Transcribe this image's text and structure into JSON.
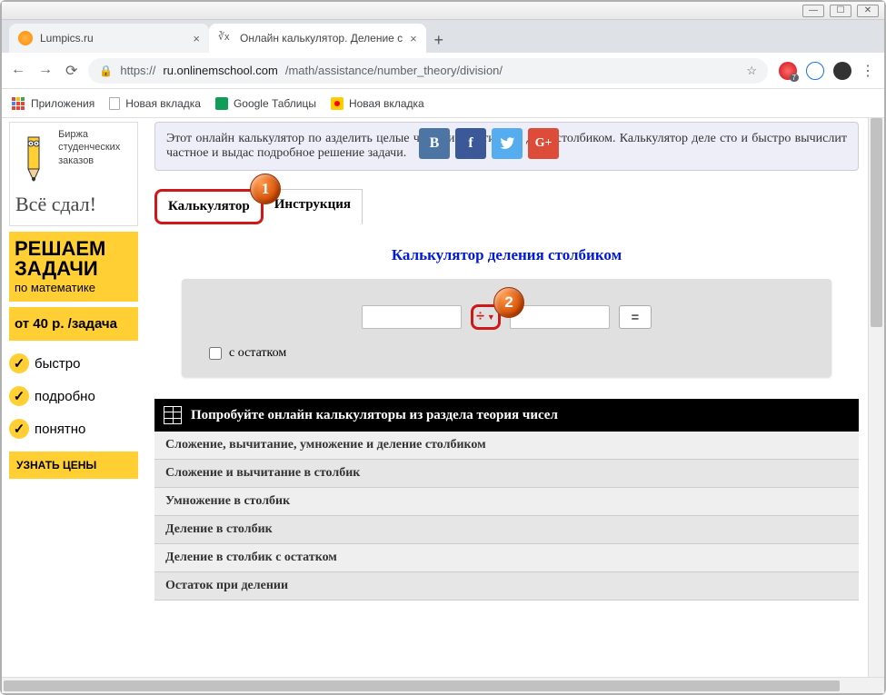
{
  "window": {
    "controls": {
      "min": "—",
      "max": "☐",
      "close": "✕"
    }
  },
  "browser": {
    "tabs": [
      {
        "title": "Lumpics.ru",
        "active": false
      },
      {
        "title": "Онлайн калькулятор. Деление с",
        "active": true
      }
    ],
    "url_prefix": "https://",
    "url_host": "ru.onlinemschool.com",
    "url_path": "/math/assistance/number_theory/division/",
    "badge_count": "7",
    "bookmarks": {
      "apps": "Приложения",
      "newtab1": "Новая вкладка",
      "sheets": "Google Таблицы",
      "newtab2": "Новая вкладка"
    }
  },
  "sidebar": {
    "ad1_line1": "Биржа",
    "ad1_line2": "студенческих",
    "ad1_line3": "заказов",
    "vse": "Всё сдал!",
    "solve1": "РЕШАЕМ",
    "solve2": "ЗАДАЧИ",
    "solve_sub": "по математике",
    "price": "от 40 р. /задача",
    "b1": "быстро",
    "b2": "подробно",
    "b3": "понятно",
    "btn": "УЗНАТЬ ЦЕНЫ"
  },
  "page": {
    "intro": "Этот онлайн калькулятор по                                                        азделить целые числа и десятичные дроб столбиком. Калькулятор деле                                            сто и быстро вычислит частное и выдас подробное решение задачи.",
    "tab_calc": "Калькулятор",
    "tab_instr": "Инструкция",
    "marker1": "1",
    "marker2": "2",
    "calc_title": "Калькулятор деления столбиком",
    "operator": "÷",
    "equals": "=",
    "remainder_label": "с остатком",
    "related_header": "Попробуйте онлайн калькуляторы из раздела теория чисел",
    "related": [
      "Сложение, вычитание, умножение и деление столбиком",
      "Сложение и вычитание в столбик",
      "Умножение в столбик",
      "Деление в столбик",
      "Деление в столбик с остатком",
      "Остаток при делении"
    ]
  }
}
